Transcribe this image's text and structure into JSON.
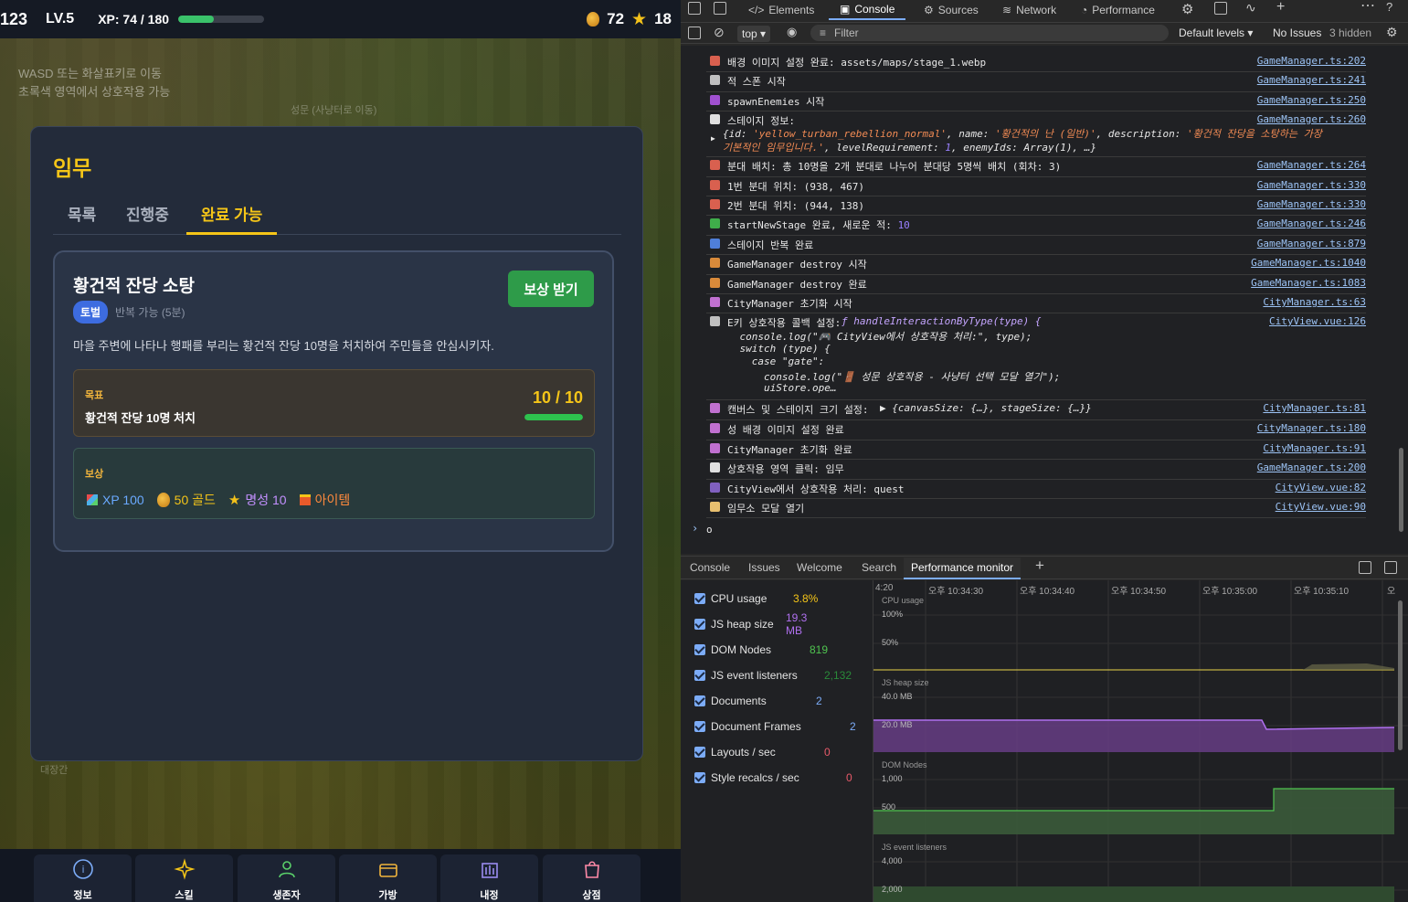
{
  "hud": {
    "score": "123",
    "level": "LV.5",
    "xp": "XP: 74 / 180",
    "xp_fraction": 0.41,
    "gold": "72",
    "fame": "18"
  },
  "map": {
    "hint1": "WASD 또는 화살표키로 이동",
    "hint2": "초록색 영역에서 상호작용 가능",
    "gate_label": "성문 (사냥터로 이동)",
    "hall_label": "대장간"
  },
  "quest_modal": {
    "title": "임무",
    "tabs": [
      "목록",
      "진행중",
      "완료 가능"
    ],
    "active_tab": "완료 가능",
    "quest": {
      "title": "황건적 잔당 소탕",
      "claim_label": "보상 받기",
      "badge": "토벌",
      "repeat": "반복 가능 (5분)",
      "description": "마을 주변에 나타나 행패를 부리는 황건적 잔당 10명을 처치하여 주민들을 안심시키자.",
      "goal_label": "목표",
      "goal_text": "황건적 잔당 10명 처치",
      "goal_count": "10 / 10",
      "goal_progress": 1.0,
      "reward_label": "보상",
      "rewards": {
        "xp": "XP 100",
        "gold": "50 골드",
        "fame": "명성 10",
        "item": "아이템"
      }
    }
  },
  "bottom_nav": [
    "정보",
    "스킬",
    "생존자",
    "가방",
    "내정",
    "상점"
  ],
  "devtools": {
    "tabs": [
      "Elements",
      "Console",
      "Sources",
      "Network",
      "Performance"
    ],
    "active_tab": "Console",
    "context": "top",
    "filter_placeholder": "Filter",
    "levels": "Default levels",
    "issues": "No Issues",
    "hidden": "3 hidden",
    "console_rows": [
      {
        "msg": "배경 이미지 설정 완료: assets/maps/stage_1.webp",
        "src": "GameManager.ts:202",
        "color": "#d9604f"
      },
      {
        "msg": "적 스폰 시작",
        "src": "GameManager.ts:241",
        "color": "#c0c0c0"
      },
      {
        "msg": "spawnEnemies 시작",
        "src": "GameManager.ts:250",
        "color": "#a050d0"
      },
      {
        "msg": "스테이지 정보:",
        "src": "GameManager.ts:260",
        "color": "#e0e0e0"
      },
      {
        "msg": "분대 배치: 총 10명을 2개 분대로 나누어 분대당 5명씩 배치 (회차: 3)",
        "src": "GameManager.ts:264",
        "color": "#d9604f"
      },
      {
        "msg": "1번 분대 위치: (938, 467)",
        "src": "GameManager.ts:330",
        "color": "#d9604f"
      },
      {
        "msg": "2번 분대 위치: (944, 138)",
        "src": "GameManager.ts:330",
        "color": "#d9604f"
      },
      {
        "msg": "startNewStage 완료, 새로운 적: ",
        "num": "10",
        "src": "GameManager.ts:246",
        "color": "#3fae4a"
      },
      {
        "msg": "스테이지 반복 완료",
        "src": "GameManager.ts:879",
        "color": "#4f7fd9"
      },
      {
        "msg": "GameManager destroy 시작",
        "src": "GameManager.ts:1040",
        "color": "#d98a3a"
      },
      {
        "msg": "GameManager destroy 완료",
        "src": "GameManager.ts:1083",
        "color": "#d98a3a"
      },
      {
        "msg": "CityManager 초기화 시작",
        "src": "CityManager.ts:63",
        "color": "#c070d0"
      },
      {
        "msg": "E키 상호작용 콜백 설정:",
        "src": "CityView.vue:126",
        "color": "#c0c0c0"
      },
      {
        "msg": "캔버스 및 스테이지 크기 설정:",
        "src": "CityManager.ts:81",
        "color": "#c070d0"
      },
      {
        "msg": "성 배경 이미지 설정 완료",
        "src": "CityManager.ts:180",
        "color": "#c070d0"
      },
      {
        "msg": "CityManager 초기화 완료",
        "src": "CityManager.ts:91",
        "color": "#c070d0"
      },
      {
        "msg": "상호작용 영역 클릭: 임무",
        "src": "GameManager.ts:200",
        "color": "#e0e0e0"
      },
      {
        "msg": "CityView에서 상호작용 처리: quest",
        "src": "CityView.vue:82",
        "color": "#8060c0"
      },
      {
        "msg": "임무소 모달 열기",
        "src": "CityView.vue:90",
        "color": "#e8c070"
      }
    ],
    "stage_obj": {
      "line1a": "{id: ",
      "id": "'yellow_turban_rebellion_normal'",
      "name_k": ", name: ",
      "name": "'황건적의 난 (일반)'",
      "desc_k": ", description: ",
      "desc": "'황건적 잔당을 소탕하는 가장",
      "line2": "기본적인 임무입니다.'",
      "lvl_k": ", levelRequirement: ",
      "lvl": "1",
      "enemy_k": ", enemyIds: Array(1), …}"
    },
    "fn_lines": [
      "handleInteractionByType(type) {",
      "    console.log(\"🎮 CityView에서 상호작용 처리:\", type);",
      "    switch (type) {",
      "      case \"gate\":",
      "        console.log(\"🚪 성문 상호작용 - 사냥터 선택 모달 열기\");",
      "        uiStore.ope…"
    ],
    "canvas_obj": "{canvasSize: {…}, stageSize: {…}}",
    "cursor": "o",
    "drawer_tabs": [
      "Console",
      "Issues",
      "Welcome",
      "Search",
      "Performance monitor"
    ],
    "drawer_active": "Performance monitor",
    "perf_metrics": [
      {
        "label": "CPU usage",
        "value": "3.8%",
        "color": "#f5c518"
      },
      {
        "label": "JS heap size",
        "value": "19.3 MB",
        "color": "#b070f0"
      },
      {
        "label": "DOM Nodes",
        "value": "819",
        "color": "#4fc34f"
      },
      {
        "label": "JS event listeners",
        "value": "2,132",
        "color": "#2a8a3a"
      },
      {
        "label": "Documents",
        "value": "2",
        "color": "#7cacf8"
      },
      {
        "label": "Document Frames",
        "value": "2",
        "color": "#7cacf8"
      },
      {
        "label": "Layouts / sec",
        "value": "0",
        "color": "#e85a6a"
      },
      {
        "label": "Style recalcs / sec",
        "value": "0",
        "color": "#e85a6a"
      }
    ],
    "time_labels": [
      "4:20",
      "오후 10:34:30",
      "오후 10:34:40",
      "오후 10:34:50",
      "오후 10:35:00",
      "오후 10:35:10",
      "오"
    ],
    "chart_labels": {
      "cpu": "CPU usage",
      "cpu_100": "100%",
      "cpu_50": "50%",
      "heap": "JS heap size",
      "heap_40": "40.0 MB",
      "heap_20": "20.0 MB",
      "dom": "DOM Nodes",
      "dom_1000": "1,000",
      "dom_500": "500",
      "jsev": "JS event listeners",
      "jsev_4000": "4,000",
      "jsev_2000": "2,000"
    }
  }
}
